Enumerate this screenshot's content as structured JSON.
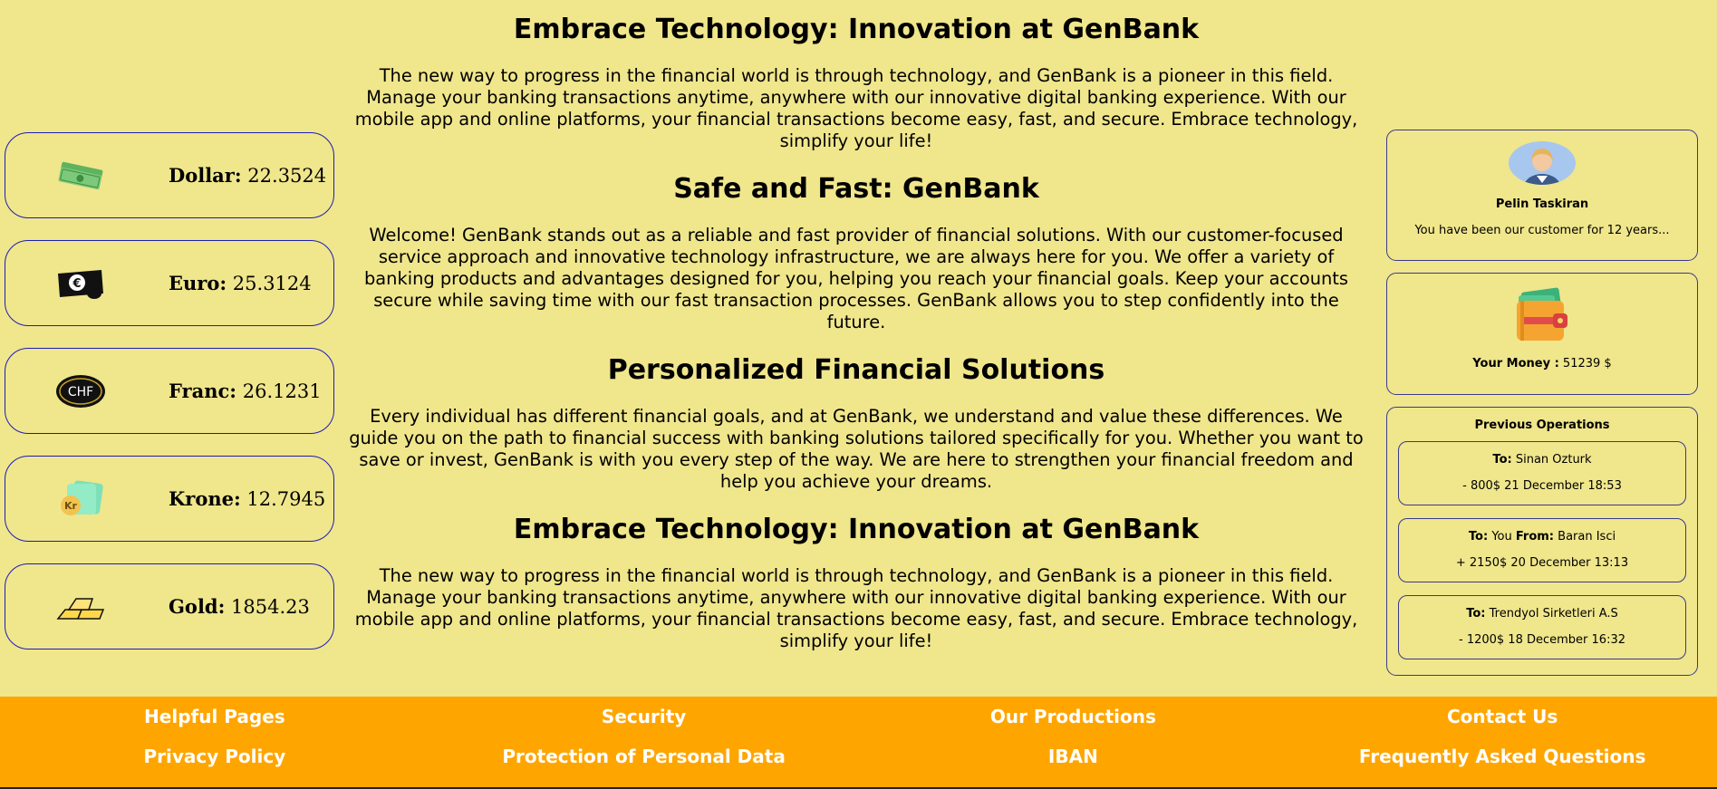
{
  "currencies": [
    {
      "icon": "money-stack-icon",
      "label": "Dollar:",
      "value": "22.3524"
    },
    {
      "icon": "euro-wallet-icon",
      "label": "Euro:",
      "value": "25.3124"
    },
    {
      "icon": "chf-coin-icon",
      "label": "Franc:",
      "value": "26.1231"
    },
    {
      "icon": "krone-money-icon",
      "label": "Krone:",
      "value": "12.7945"
    },
    {
      "icon": "gold-bars-icon",
      "label": "Gold:",
      "value": "1854.23"
    }
  ],
  "sections": [
    {
      "title": "Embrace Technology: Innovation at GenBank",
      "text": "The new way to progress in the financial world is through technology, and GenBank is a pioneer in this field. Manage your banking transactions anytime, anywhere with our innovative digital banking experience. With our mobile app and online platforms, your financial transactions become easy, fast, and secure. Embrace technology, simplify your life!"
    },
    {
      "title": "Safe and Fast: GenBank",
      "text": "Welcome! GenBank stands out as a reliable and fast provider of financial solutions. With our customer-focused service approach and innovative technology infrastructure, we are always here for you. We offer a variety of banking products and advantages designed for you, helping you reach your financial goals. Keep your accounts secure while saving time with our fast transaction processes. GenBank allows you to step confidently into the future."
    },
    {
      "title": "Personalized Financial Solutions",
      "text": "Every individual has different financial goals, and at GenBank, we understand and value these differences. We guide you on the path to financial success with banking solutions tailored specifically for you. Whether you want to save or invest, GenBank is with you every step of the way. We are here to strengthen your financial freedom and help you achieve your dreams."
    },
    {
      "title": "Embrace Technology: Innovation at GenBank",
      "text": "The new way to progress in the financial world is through technology, and GenBank is a pioneer in this field. Manage your banking transactions anytime, anywhere with our innovative digital banking experience. With our mobile app and online platforms, your financial transactions become easy, fast, and secure. Embrace technology, simplify your life!"
    }
  ],
  "profile": {
    "name": "Pelin Taskiran",
    "subtitle": "You have been our customer for 12 years..."
  },
  "money": {
    "label": "Your Money :",
    "value": "51239 $"
  },
  "operations": {
    "title": "Previous Operations",
    "items": [
      {
        "to_label": "To:",
        "to": "Sinan Ozturk",
        "from_label": "",
        "from": "",
        "detail": "- 800$ 21 December 18:53"
      },
      {
        "to_label": "To:",
        "to": "You",
        "from_label": "From:",
        "from": "Baran Isci",
        "detail": "+ 2150$ 20 December 13:13"
      },
      {
        "to_label": "To:",
        "to": "Trendyol Sirketleri A.S",
        "from_label": "",
        "from": "",
        "detail": "- 1200$ 18 December 16:32"
      }
    ]
  },
  "footer": {
    "row1": [
      "Helpful Pages",
      "Security",
      "Our Productions",
      "Contact Us"
    ],
    "row2": [
      "Privacy Policy",
      "Protection of Personal Data",
      "IBAN",
      "Frequently Asked Questions"
    ]
  },
  "colors": {
    "background": "#f0e68c",
    "footer": "#ffa500",
    "card_border": "#1c1cb8"
  }
}
